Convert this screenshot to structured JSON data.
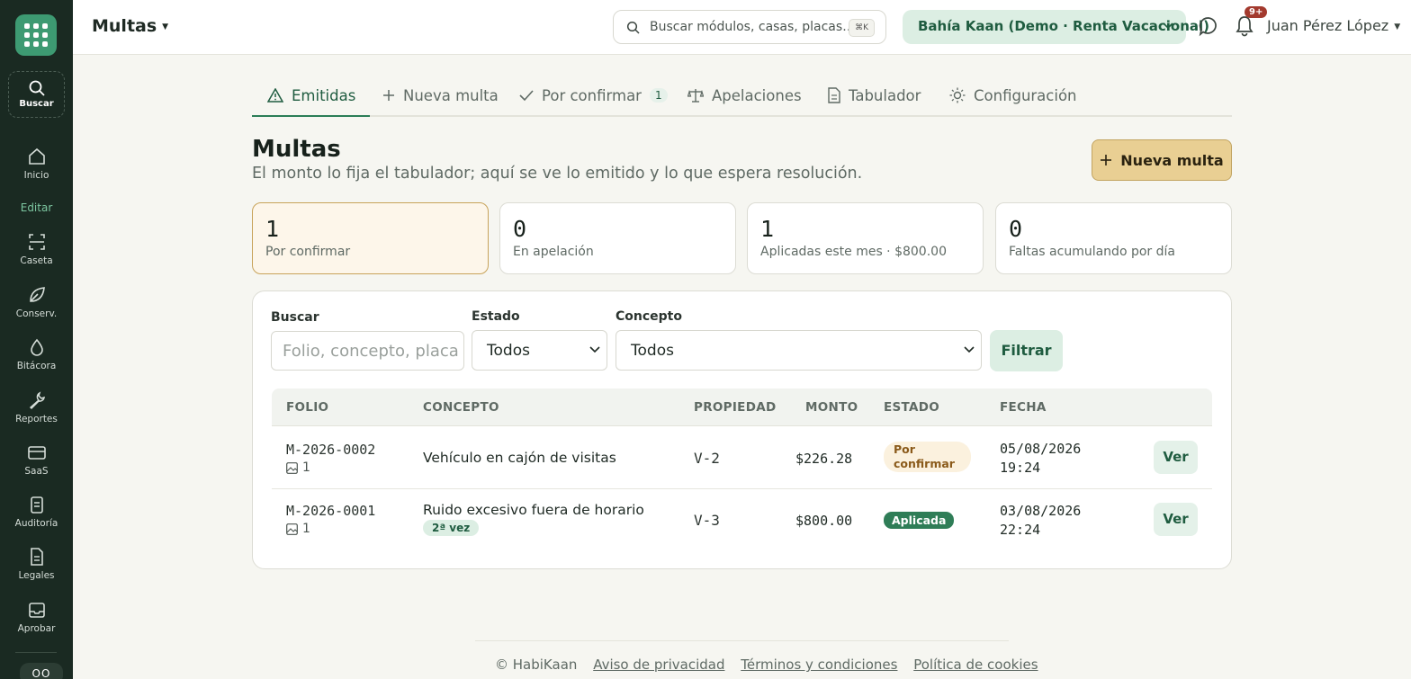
{
  "sidebar": {
    "search_label": "Buscar",
    "section_label": "Editar",
    "items": [
      {
        "label": "Inicio",
        "icon": "home-icon"
      },
      {
        "label": "Caseta",
        "icon": "scan-icon"
      },
      {
        "label": "Conserv.",
        "icon": "leaf-icon"
      },
      {
        "label": "Bitácora",
        "icon": "drop-icon"
      },
      {
        "label": "Reportes",
        "icon": "wrench-icon"
      },
      {
        "label": "SaaS",
        "icon": "card-icon"
      },
      {
        "label": "Auditoría",
        "icon": "clipboard-icon"
      },
      {
        "label": "Legales",
        "icon": "document-icon"
      },
      {
        "label": "Aprobar",
        "icon": "inbox-icon"
      }
    ],
    "bottom_label": "OO"
  },
  "header": {
    "title": "Multas",
    "search_placeholder": "Buscar módulos, casas, placas…",
    "shortcut": "⌘K",
    "tenant": "Bahía Kaan (Demo · Renta Vacacional)",
    "notifications_badge": "9+",
    "user": "Juan Pérez López"
  },
  "tabs": [
    {
      "label": "Emitidas",
      "icon": "warning-icon",
      "active": true
    },
    {
      "label": "Nueva multa",
      "icon": "plus-icon"
    },
    {
      "label": "Por confirmar",
      "icon": "check-icon",
      "count": "1"
    },
    {
      "label": "Apelaciones",
      "icon": "scale-icon"
    },
    {
      "label": "Tabulador",
      "icon": "document-icon"
    },
    {
      "label": "Configuración",
      "icon": "sun-icon"
    }
  ],
  "page": {
    "title": "Multas",
    "subtitle": "El monto lo fija el tabulador; aquí se ve lo emitido y lo que espera resolución.",
    "new_button": "Nueva multa"
  },
  "stats": [
    {
      "value": "1",
      "label": "Por confirmar"
    },
    {
      "value": "0",
      "label": "En apelación"
    },
    {
      "value": "1",
      "label": "Aplicadas este mes · $800.00"
    },
    {
      "value": "0",
      "label": "Faltas acumulando por día"
    }
  ],
  "filters": {
    "search_label": "Buscar",
    "search_placeholder": "Folio, concepto, placa",
    "estado_label": "Estado",
    "estado_value": "Todos",
    "concepto_label": "Concepto",
    "concepto_value": "Todos",
    "filter_button": "Filtrar"
  },
  "table": {
    "columns": [
      "FOLIO",
      "CONCEPTO",
      "PROPIEDAD",
      "MONTO",
      "ESTADO",
      "FECHA"
    ],
    "rows": [
      {
        "folio": "M-2026-0002",
        "attachments": "1",
        "concepto": "Vehículo en cajón de visitas",
        "chip": "",
        "propiedad": "V-2",
        "monto": "$226.28",
        "estado": "Por confirmar",
        "estado_color": "#fbf1de",
        "fecha_date": "05/08/2026",
        "fecha_time": "19:24",
        "action": "Ver"
      },
      {
        "folio": "M-2026-0001",
        "attachments": "1",
        "concepto": "Ruido excesivo fuera de horario",
        "chip": "2ª vez",
        "propiedad": "V-3",
        "monto": "$800.00",
        "estado": "Aplicada",
        "estado_color": "#2f7d57",
        "fecha_date": "03/08/2026",
        "fecha_time": "22:24",
        "action": "Ver"
      }
    ]
  },
  "footer": {
    "copyright": "© HabiKaan",
    "links": [
      "Aviso de privacidad",
      "Términos y condiciones",
      "Política de cookies"
    ]
  },
  "colors": {
    "sidebar_bg": "#1a2a22",
    "accent_green": "#2b7d57",
    "accent_gold": "#e9cf93"
  }
}
